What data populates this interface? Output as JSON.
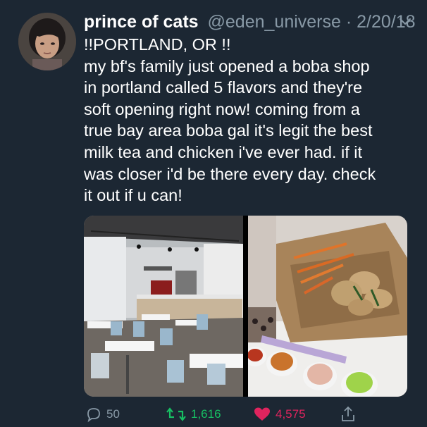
{
  "tweet": {
    "display_name": "prince of cats",
    "handle": "@eden_universe",
    "separator": "·",
    "date": "2/20/18",
    "text_lines": [
      "!!PORTLAND, OR !!",
      "my bf's family just opened a boba shop",
      "in portland called 5 flavors  and they're",
      "soft opening right now! coming from a",
      "true bay area boba gal it's legit the best",
      "milk tea and chicken i've ever had. if it",
      "was closer i'd be there every day. check",
      "it out if u can!"
    ],
    "media": [
      {
        "description_icon": "cafe-interior-photo"
      },
      {
        "description_icon": "food-photo"
      }
    ]
  },
  "actions": {
    "reply": {
      "icon": "reply-icon",
      "count": "50"
    },
    "retweet": {
      "icon": "retweet-icon",
      "count": "1,616",
      "color": "#17bf63"
    },
    "like": {
      "icon": "heart-icon",
      "count": "4,575",
      "color": "#e0245e"
    },
    "share": {
      "icon": "share-icon"
    }
  },
  "colors": {
    "background": "#1c2733",
    "secondary_text": "#8899a6"
  }
}
